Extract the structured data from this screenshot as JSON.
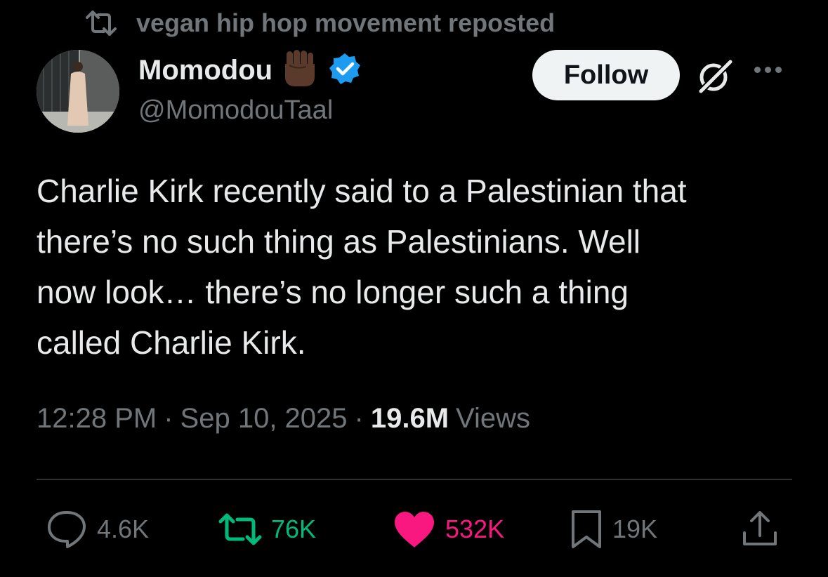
{
  "repost_header": {
    "icon": "repost-icon",
    "text": "vegan hip hop movement reposted"
  },
  "author": {
    "display_name": "Momodou",
    "emoji": "✊🏿",
    "verified_icon": "verified-badge-icon",
    "handle": "@MomodouTaal"
  },
  "header_actions": {
    "follow_label": "Follow",
    "grok_icon": "grok-icon",
    "more_icon": "more-options-icon"
  },
  "tweet": {
    "text": "Charlie Kirk recently said to a Palestinian that\nthere’s no such thing as Palestinians. Well\nnow look… there’s no longer such a thing\ncalled Charlie Kirk."
  },
  "meta": {
    "time": "12:28 PM",
    "separator": "·",
    "date": "Sep 10, 2025",
    "views_count": "19.6M",
    "views_label": "Views"
  },
  "actions": {
    "reply": {
      "icon": "reply-icon",
      "count": "4.6K"
    },
    "repost": {
      "icon": "repost-icon",
      "count": "76K"
    },
    "like": {
      "icon": "heart-filled-icon",
      "count": "532K"
    },
    "bookmark": {
      "icon": "bookmark-icon",
      "count": "19K"
    },
    "share": {
      "icon": "share-icon"
    }
  },
  "colors": {
    "background": "#000000",
    "text_primary": "#e7e9ea",
    "text_secondary": "#71767b",
    "verified_blue": "#1d9bf0",
    "repost_green": "#00ba7c",
    "like_pink": "#f91880",
    "follow_button_bg": "#eff3f4"
  }
}
